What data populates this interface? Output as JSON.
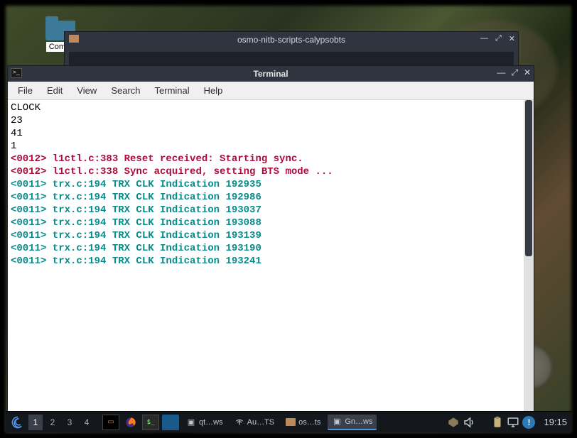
{
  "desktop": {
    "folder_label": "Comm"
  },
  "file_manager": {
    "title": "osmo-nitb-scripts-calypsobts",
    "controls": {
      "min": "—",
      "max": "⤢",
      "close": "✕"
    }
  },
  "terminal": {
    "title": "Terminal",
    "controls": {
      "min": "—",
      "max": "⤢",
      "close": "✕"
    },
    "menu": {
      "file": "File",
      "edit": "Edit",
      "view": "View",
      "search": "Search",
      "terminal": "Terminal",
      "help": "Help"
    },
    "lines": {
      "plain": [
        "CLOCK",
        "23",
        "41",
        "1"
      ],
      "sync": [
        "<0012> l1ctl.c:383 Reset received: Starting sync.",
        "<0012> l1ctl.c:338 Sync acquired, setting BTS mode ..."
      ],
      "trx": [
        "<0011> trx.c:194 TRX CLK Indication 192935",
        "<0011> trx.c:194 TRX CLK Indication 192986",
        "<0011> trx.c:194 TRX CLK Indication 193037",
        "<0011> trx.c:194 TRX CLK Indication 193088",
        "<0011> trx.c:194 TRX CLK Indication 193139",
        "<0011> trx.c:194 TRX CLK Indication 193190",
        "<0011> trx.c:194 TRX CLK Indication 193241"
      ]
    }
  },
  "taskbar": {
    "workspaces": [
      "1",
      "2",
      "3",
      "4"
    ],
    "tasks": {
      "t1": "qt…ws",
      "t2": "Au…TS",
      "t3": "os…ts",
      "t4": "Gn…ws"
    },
    "clock": "19:15",
    "badge": "!"
  }
}
